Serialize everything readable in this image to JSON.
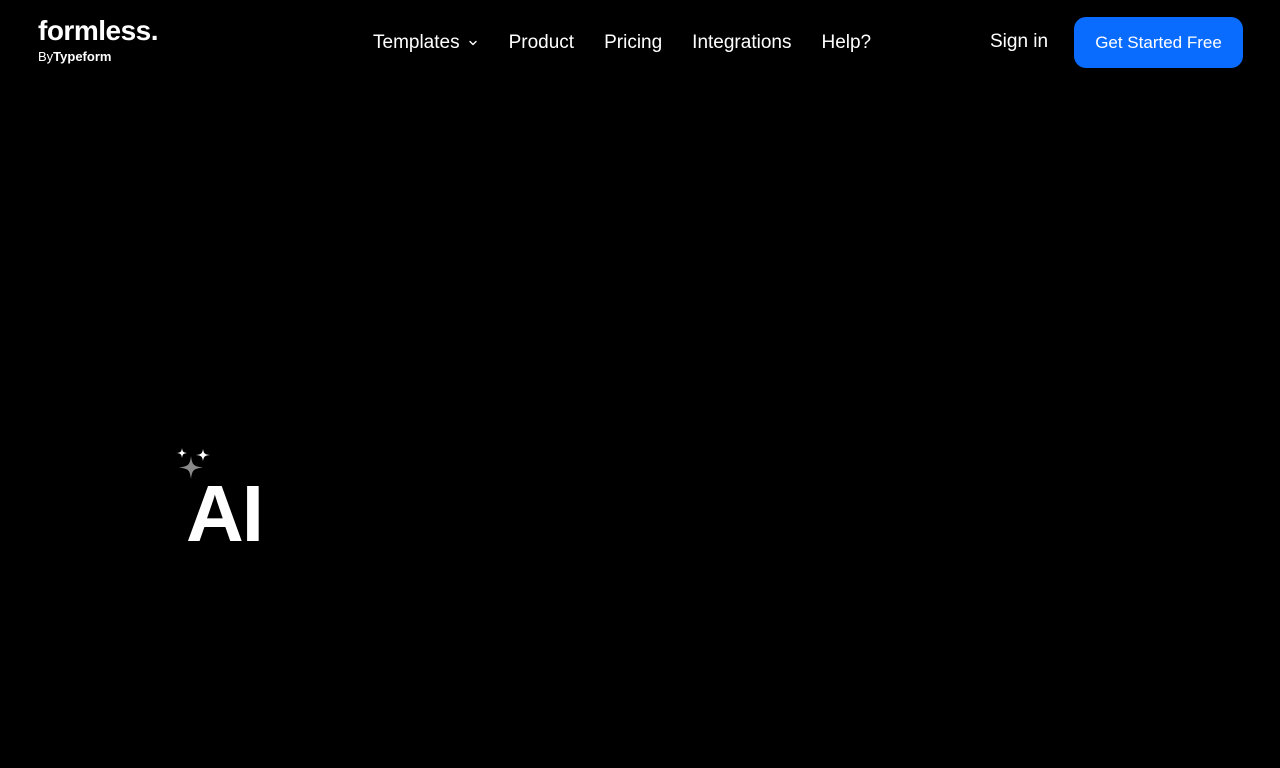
{
  "header": {
    "logo": {
      "wordmark": "formless.",
      "by": "By",
      "brand": "Typeform"
    },
    "nav": [
      {
        "label": "Templates",
        "has_dropdown": true
      },
      {
        "label": "Product"
      },
      {
        "label": "Pricing"
      },
      {
        "label": "Integrations"
      },
      {
        "label": "Help?"
      }
    ],
    "sign_in": "Sign in",
    "cta": "Get Started Free"
  },
  "hero": {
    "badge_text": "AI",
    "icon": "sparkles-icon"
  },
  "colors": {
    "background": "#000000",
    "text": "#ffffff",
    "accent": "#0a6cff",
    "sparkle_muted": "#8a8a8a"
  }
}
